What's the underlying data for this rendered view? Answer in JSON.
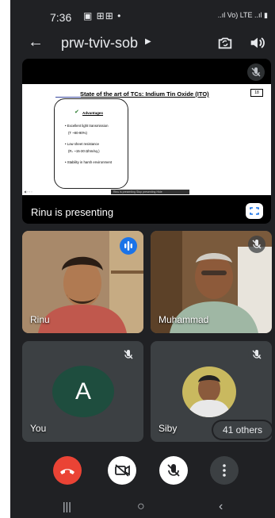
{
  "status_bar": {
    "time": "7:36",
    "notif_icons": "▣ ⊞⊞ •",
    "right_icons": "..ıl Vo) LTE ..ıl ▮"
  },
  "header": {
    "back_icon": "arrow-left",
    "meeting_code": "prw-tviv-sob",
    "caret": "▶"
  },
  "presentation": {
    "slide_title": "State of the art of TCs: Indium Tin Oxide (ITO)",
    "slide_number": "18",
    "advantages_heading": "Advantages",
    "bullets": [
      "• Excellent light transmission",
      "(T ~80-90%)",
      "• Low sheet resistance",
      "(Rₛ ~15-30 Ωhm/sq.)",
      "• Stability in harsh environment"
    ],
    "bottom_bar_text": "Rinu is presenting   Stop presenting   Hide",
    "presenter_label": "Rinu is presenting"
  },
  "participants": [
    {
      "name": "Rinu"
    },
    {
      "name": "Muhammad"
    },
    {
      "name": "You",
      "initial": "A",
      "avatar_color": "#1e4d3e"
    },
    {
      "name": "Siby"
    }
  ],
  "others_badge": "41 others",
  "colors": {
    "end_call": "#ea4335",
    "background": "#202124",
    "tile": "#3c4043",
    "active_speaker": "#4c8bf5"
  }
}
